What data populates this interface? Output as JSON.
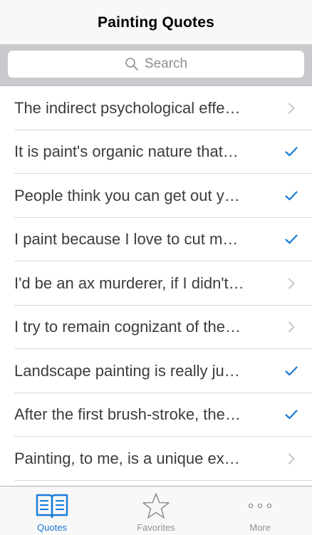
{
  "header": {
    "title": "Painting Quotes"
  },
  "search": {
    "placeholder": "Search",
    "icon": "search-icon"
  },
  "colors": {
    "accent": "#1a7bd6",
    "chevron": "#c7c7cc",
    "search_bar_bg": "#c9c9ce"
  },
  "quotes": [
    {
      "text": "The indirect psychological effe…",
      "accessory": "chevron"
    },
    {
      "text": "It is paint's organic nature that…",
      "accessory": "checkmark"
    },
    {
      "text": "People think you can get out y…",
      "accessory": "checkmark"
    },
    {
      "text": "I paint because I love to cut m…",
      "accessory": "checkmark"
    },
    {
      "text": "I'd be an ax murderer, if I didn't…",
      "accessory": "chevron"
    },
    {
      "text": "I try to remain cognizant of the…",
      "accessory": "chevron"
    },
    {
      "text": "Landscape painting is really ju…",
      "accessory": "checkmark"
    },
    {
      "text": "After the first brush-stroke, the…",
      "accessory": "checkmark"
    },
    {
      "text": "Painting, to me, is a unique ex…",
      "accessory": "chevron"
    }
  ],
  "tabbar": {
    "tabs": [
      {
        "label": "Quotes",
        "icon": "book-icon",
        "active": true
      },
      {
        "label": "Favorites",
        "icon": "star-icon",
        "active": false
      },
      {
        "label": "More",
        "icon": "more-icon",
        "active": false
      }
    ]
  }
}
